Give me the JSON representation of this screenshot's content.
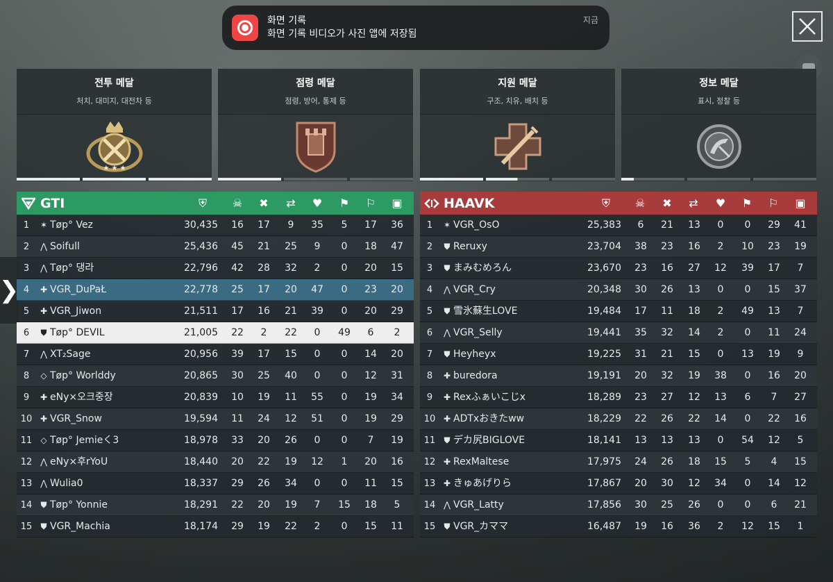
{
  "notification": {
    "title": "화면 기록",
    "message": "화면 기록 비디오가 사진 앱에 저장됨",
    "time": "지금",
    "app_icon": "record-icon"
  },
  "medals": [
    {
      "title": "전투 메달",
      "subtitle": "처치, 대미지, 대전차 등",
      "icon": "combat-medal-icon",
      "progress": [
        1,
        1,
        1
      ]
    },
    {
      "title": "점령 메달",
      "subtitle": "점령, 방어, 통제 등",
      "icon": "objective-medal-icon",
      "progress": [
        1,
        0,
        0
      ]
    },
    {
      "title": "지원 메달",
      "subtitle": "구조, 치유, 배치 등",
      "icon": "support-medal-icon",
      "progress": [
        1,
        0.5,
        0
      ]
    },
    {
      "title": "정보 메달",
      "subtitle": "표시, 정찰 등",
      "icon": "intel-medal-icon",
      "progress": [
        0.1,
        0,
        0
      ]
    }
  ],
  "columns": [
    "score-icon",
    "kills-icon",
    "deaths-icon",
    "assists-icon",
    "revives-icon",
    "captures-icon",
    "objective-icon",
    "support-icon"
  ],
  "teams": [
    {
      "name": "GTI",
      "color": "#2d9a63",
      "rows": [
        {
          "rank": "1",
          "cls": "✶",
          "name": "Tøp°  Vez",
          "score": "30,435",
          "stats": [
            "16",
            "17",
            "9",
            "35",
            "5",
            "17",
            "36"
          ]
        },
        {
          "rank": "2",
          "cls": "⋀",
          "name": "Soifull",
          "score": "25,436",
          "stats": [
            "45",
            "21",
            "25",
            "9",
            "0",
            "18",
            "47"
          ]
        },
        {
          "rank": "3",
          "cls": "⋀",
          "name": "Tøp°  댕라",
          "score": "22,796",
          "stats": [
            "42",
            "28",
            "32",
            "2",
            "0",
            "20",
            "15"
          ]
        },
        {
          "rank": "4",
          "cls": "✚",
          "name": "VGR_DuPaŁ",
          "score": "22,778",
          "stats": [
            "25",
            "17",
            "20",
            "47",
            "0",
            "23",
            "20"
          ],
          "hl": "blue"
        },
        {
          "rank": "5",
          "cls": "✚",
          "name": "VGR_Jiwon",
          "score": "21,511",
          "stats": [
            "17",
            "16",
            "21",
            "39",
            "0",
            "20",
            "29"
          ]
        },
        {
          "rank": "6",
          "cls": "⛊",
          "name": "Tøp°  DEVIL",
          "score": "21,005",
          "stats": [
            "22",
            "2",
            "22",
            "0",
            "49",
            "6",
            "2"
          ],
          "hl": "white"
        },
        {
          "rank": "7",
          "cls": "⋀",
          "name": "XT₂Sage",
          "score": "20,956",
          "stats": [
            "39",
            "17",
            "15",
            "0",
            "0",
            "14",
            "20"
          ]
        },
        {
          "rank": "8",
          "cls": "◇",
          "name": "Tøp°  Worlddy",
          "score": "20,865",
          "stats": [
            "30",
            "25",
            "40",
            "0",
            "0",
            "12",
            "31"
          ]
        },
        {
          "rank": "9",
          "cls": "✚",
          "name": "eNy×오크중장",
          "score": "20,839",
          "stats": [
            "10",
            "19",
            "11",
            "55",
            "0",
            "19",
            "34"
          ]
        },
        {
          "rank": "10",
          "cls": "✚",
          "name": "VGR_Snow",
          "score": "19,594",
          "stats": [
            "11",
            "24",
            "12",
            "51",
            "0",
            "19",
            "29"
          ]
        },
        {
          "rank": "11",
          "cls": "◇",
          "name": "Tøp°  Jemieく3",
          "score": "18,978",
          "stats": [
            "33",
            "20",
            "26",
            "0",
            "0",
            "7",
            "19"
          ]
        },
        {
          "rank": "12",
          "cls": "⋀",
          "name": "eNy×후rYoU",
          "score": "18,440",
          "stats": [
            "20",
            "22",
            "19",
            "12",
            "1",
            "20",
            "16"
          ]
        },
        {
          "rank": "13",
          "cls": "⋀",
          "name": "Wulia0",
          "score": "18,337",
          "stats": [
            "29",
            "26",
            "34",
            "0",
            "0",
            "11",
            "15"
          ]
        },
        {
          "rank": "14",
          "cls": "⛊",
          "name": "Tøp°  Yonnie",
          "score": "18,291",
          "stats": [
            "22",
            "20",
            "19",
            "7",
            "15",
            "18",
            "5"
          ]
        },
        {
          "rank": "15",
          "cls": "⛊",
          "name": "VGR_Machia",
          "score": "18,174",
          "stats": [
            "29",
            "19",
            "22",
            "2",
            "0",
            "15",
            "11"
          ]
        }
      ]
    },
    {
      "name": "HAAVK",
      "color": "#a83c3c",
      "rows": [
        {
          "rank": "1",
          "cls": "✶",
          "name": "VGR_OsO",
          "score": "25,383",
          "stats": [
            "6",
            "21",
            "13",
            "0",
            "0",
            "29",
            "41"
          ]
        },
        {
          "rank": "2",
          "cls": "⛊",
          "name": "Reruxy",
          "score": "23,704",
          "stats": [
            "38",
            "23",
            "16",
            "2",
            "10",
            "23",
            "19"
          ]
        },
        {
          "rank": "3",
          "cls": "⛊",
          "name": "まみむめろん",
          "score": "23,670",
          "stats": [
            "23",
            "16",
            "27",
            "12",
            "39",
            "17",
            "7"
          ]
        },
        {
          "rank": "4",
          "cls": "⋀",
          "name": "VGR_Cry",
          "score": "20,348",
          "stats": [
            "30",
            "26",
            "13",
            "0",
            "0",
            "15",
            "37"
          ]
        },
        {
          "rank": "5",
          "cls": "⛊",
          "name": "雪氷蘇生LOVE",
          "score": "19,484",
          "stats": [
            "17",
            "11",
            "18",
            "2",
            "49",
            "13",
            "7"
          ]
        },
        {
          "rank": "6",
          "cls": "⋀",
          "name": "VGR_Selly",
          "score": "19,441",
          "stats": [
            "35",
            "32",
            "14",
            "2",
            "0",
            "11",
            "24"
          ]
        },
        {
          "rank": "7",
          "cls": "⛊",
          "name": "Heyheyx",
          "score": "19,225",
          "stats": [
            "31",
            "21",
            "15",
            "0",
            "13",
            "19",
            "9"
          ]
        },
        {
          "rank": "8",
          "cls": "✚",
          "name": "buredora",
          "score": "19,191",
          "stats": [
            "20",
            "32",
            "19",
            "38",
            "0",
            "16",
            "20"
          ]
        },
        {
          "rank": "9",
          "cls": "✚",
          "name": "Rexふぁいこじx",
          "score": "18,289",
          "stats": [
            "23",
            "27",
            "12",
            "13",
            "6",
            "7",
            "27"
          ]
        },
        {
          "rank": "10",
          "cls": "✚",
          "name": "ADTxおきたww",
          "score": "18,229",
          "stats": [
            "22",
            "26",
            "22",
            "14",
            "0",
            "22",
            "16"
          ]
        },
        {
          "rank": "11",
          "cls": "⛊",
          "name": "デカ尻BIGLOVE",
          "score": "18,141",
          "stats": [
            "13",
            "13",
            "13",
            "0",
            "54",
            "12",
            "5"
          ]
        },
        {
          "rank": "12",
          "cls": "✚",
          "name": "RexMaltese",
          "score": "17,975",
          "stats": [
            "24",
            "26",
            "18",
            "15",
            "5",
            "4",
            "15"
          ]
        },
        {
          "rank": "13",
          "cls": "✚",
          "name": "きゅあげりら",
          "score": "17,867",
          "stats": [
            "20",
            "30",
            "12",
            "34",
            "0",
            "14",
            "12"
          ]
        },
        {
          "rank": "14",
          "cls": "⋀",
          "name": "VGR_Latty",
          "score": "17,856",
          "stats": [
            "30",
            "25",
            "26",
            "0",
            "0",
            "6",
            "21"
          ]
        },
        {
          "rank": "15",
          "cls": "⛊",
          "name": "VGR_カママ",
          "score": "16,487",
          "stats": [
            "19",
            "16",
            "36",
            "2",
            "12",
            "15",
            "1"
          ]
        }
      ]
    }
  ]
}
